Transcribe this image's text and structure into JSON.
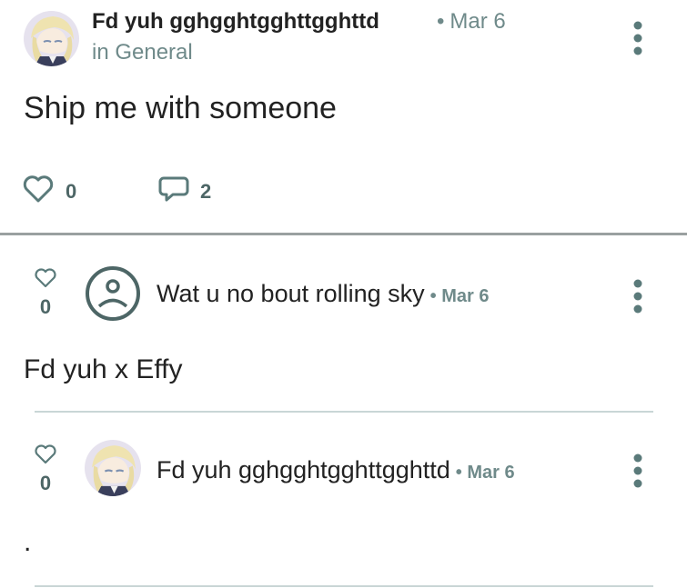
{
  "post": {
    "author": "Fd yuh gghgghtgghttgghttd",
    "date": "Mar 6",
    "date_separator": "•",
    "community": "in General",
    "body": "Ship me with someone",
    "likes": "0",
    "comments": "2"
  },
  "comments": [
    {
      "likes": "0",
      "author": "Wat u no bout rolling sky",
      "date": "• Mar 6",
      "body": "Fd yuh x Effy",
      "avatar": "default-user-icon"
    },
    {
      "likes": "0",
      "author": "Fd yuh gghgghtgghttgghttd",
      "date": "• Mar 6",
      "body": ".",
      "avatar": "anime-character-avatar"
    }
  ],
  "colors": {
    "accent": "#5a7a7a",
    "muted_text": "#6f8a8a",
    "divider": "#9aa0a0"
  }
}
